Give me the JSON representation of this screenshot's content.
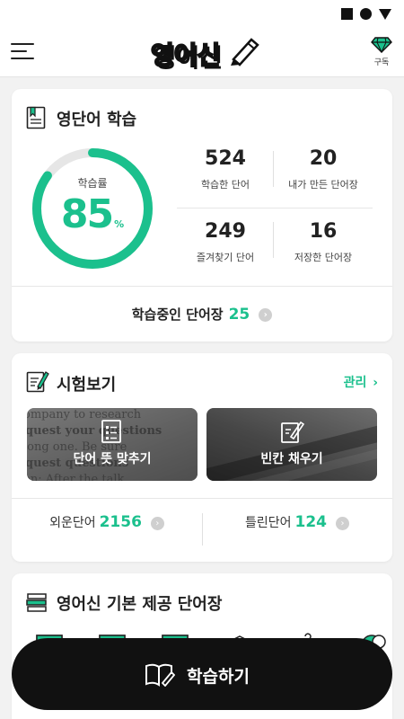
{
  "header": {
    "logo_text": "영어신",
    "subscribe_label": "구독",
    "accent_color": "#1bc08d"
  },
  "study": {
    "title": "영단어 학습",
    "progress_label": "학습률",
    "progress_value": "85",
    "progress_unit": "%",
    "progress_fraction": 0.85,
    "stats": [
      {
        "value": "524",
        "label": "학습한 단어"
      },
      {
        "value": "20",
        "label": "내가 만든 단어장"
      },
      {
        "value": "249",
        "label": "즐겨찾기 단어"
      },
      {
        "value": "16",
        "label": "저장한 단어장"
      }
    ],
    "learning_label": "학습중인 단어장",
    "learning_count": "25"
  },
  "exam": {
    "title": "시험보기",
    "manage_label": "관리",
    "buttons": [
      {
        "label": "단어 뜻 맞추기",
        "icon": "checklist-icon"
      },
      {
        "label": "빈칸 채우기",
        "icon": "edit-icon"
      }
    ],
    "memorized_label": "외운단어",
    "memorized_count": "2156",
    "wrong_label": "틀린단어",
    "wrong_count": "124"
  },
  "basic": {
    "title": "영어신 기본 제공 단어장"
  },
  "cta": {
    "label": "학습하기"
  }
}
